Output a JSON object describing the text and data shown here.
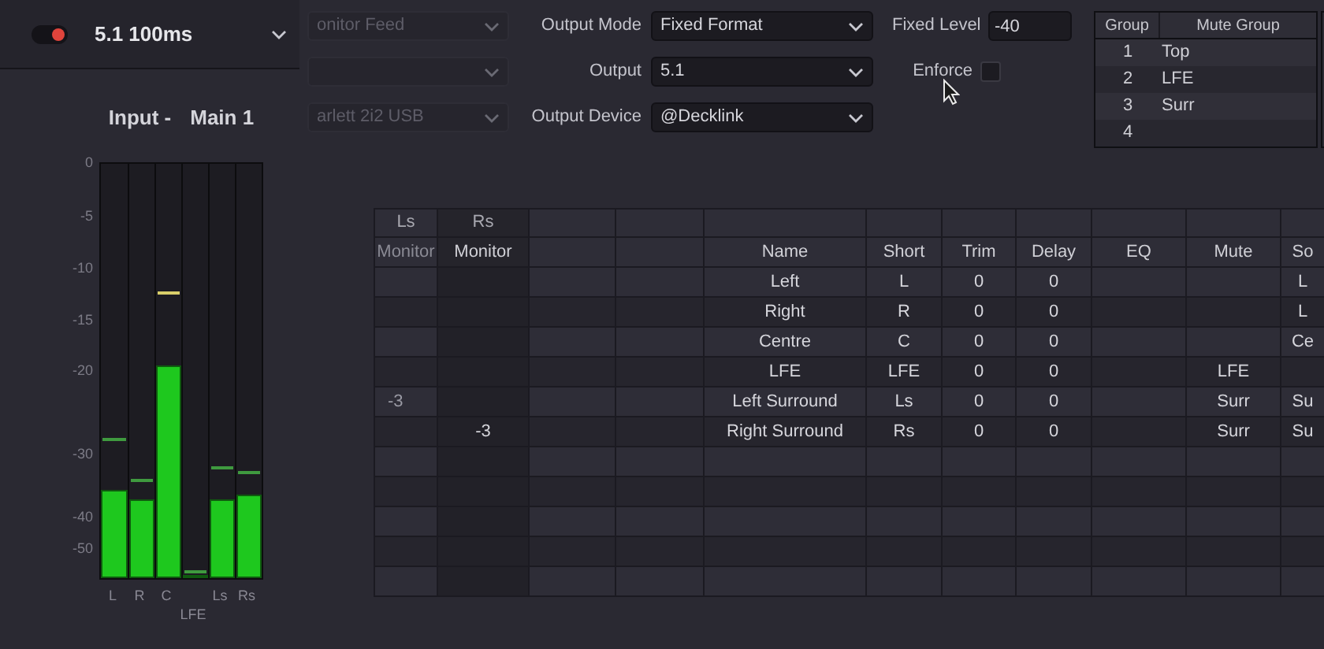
{
  "preset": {
    "toggle": {
      "on": true
    },
    "title": "5.1 100ms"
  },
  "controls": {
    "faint_fields": [
      {
        "kind": "text",
        "value": "onitor Feed"
      },
      {
        "kind": "blank"
      },
      {
        "kind": "text",
        "value": "arlett 2i2 USB"
      }
    ],
    "output_mode": {
      "label": "Output Mode",
      "value": "Fixed Format"
    },
    "output": {
      "label": "Output",
      "value": "5.1"
    },
    "output_device": {
      "label": "Output Device",
      "value": "@Decklink"
    },
    "fixed_level": {
      "label": "Fixed Level",
      "value": "-40"
    },
    "enforce": {
      "label": "Enforce",
      "checked": false
    }
  },
  "mute_groups": {
    "columns": [
      "Group",
      "Mute Group"
    ],
    "rows": [
      {
        "group": "1",
        "name": "Top"
      },
      {
        "group": "2",
        "name": "LFE"
      },
      {
        "group": "3",
        "name": "Surr"
      },
      {
        "group": "4"
      }
    ]
  },
  "meter": {
    "title": "Input -",
    "source": "Main 1",
    "ticks": [
      "0",
      "-5",
      "-10",
      "-15",
      "-20",
      "-30",
      "-40",
      "-50"
    ],
    "channels": [
      {
        "label": "L",
        "kind": "main",
        "level": 0.21,
        "peak": {
          "level": 0.33,
          "color": "#3f9a3f"
        }
      },
      {
        "label": "R",
        "kind": "main",
        "level": 0.19,
        "peak": {
          "level": 0.23,
          "color": "#3f9a3f"
        }
      },
      {
        "label": "C",
        "kind": "main",
        "level": 0.51,
        "peak": {
          "level": 0.68,
          "color": "#d9cf6a"
        }
      },
      {
        "label": "LFE",
        "kind": "sub",
        "level": 0.0,
        "peak": {
          "level": 0.01,
          "color": "#3f9a3f"
        }
      },
      {
        "label": "Ls",
        "kind": "main",
        "level": 0.19,
        "peak": {
          "level": 0.26,
          "color": "#3f9a3f"
        }
      },
      {
        "label": "Rs",
        "kind": "main",
        "level": 0.2,
        "peak": {
          "level": 0.25,
          "color": "#3f9a3f"
        }
      }
    ]
  },
  "channel_table": {
    "columns": [
      {
        "top": "Ls",
        "label": "Monitor"
      },
      {
        "top": "Rs",
        "label": "Monitor"
      },
      {
        "label": "Name"
      },
      {
        "label": "Short"
      },
      {
        "label": "Trim"
      },
      {
        "label": "Delay"
      },
      {
        "label": "EQ"
      },
      {
        "label": "Mute"
      },
      {
        "label": "So"
      }
    ],
    "rows": [
      {
        "name": "Left",
        "short": "L",
        "trim": "0",
        "delay": "0",
        "column_11": "L"
      },
      {
        "name": "Right",
        "short": "R",
        "trim": "0",
        "delay": "0",
        "column_11": "L"
      },
      {
        "name": "Centre",
        "short": "C",
        "trim": "0",
        "delay": "0",
        "column_11": "Ce"
      },
      {
        "name": "LFE",
        "short": "LFE",
        "trim": "0",
        "delay": "0",
        "mute": "LFE"
      },
      {
        "ls_monitor": "-3",
        "name": "Left Surround",
        "short": "Ls",
        "trim": "0",
        "delay": "0",
        "mute": "Surr",
        "column_11": "Su"
      },
      {
        "rs_monitor": "-3",
        "name": "Right Surround",
        "short": "Rs",
        "trim": "0",
        "delay": "0",
        "mute": "Surr",
        "column_11": "Su"
      }
    ]
  }
}
